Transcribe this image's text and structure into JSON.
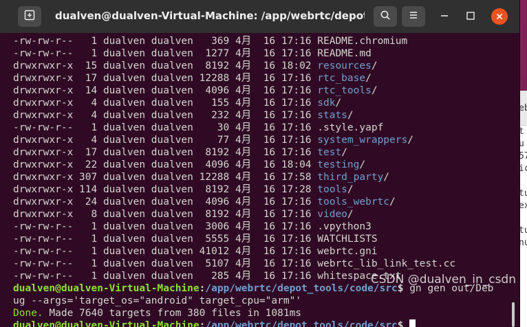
{
  "window": {
    "title": "dualven@dualven-Virtual-Machine: /app/webrtc/depot_tools..."
  },
  "background_window": {
    "fragments": [
      "eb",
      "t",
      "u",
      "57",
      "ic",
      "tu",
      "ex",
      "tu",
      "nu"
    ]
  },
  "listing": [
    {
      "perms": "-rw-rw-r--",
      "links": "1",
      "user": "dualven",
      "group": "dualven",
      "size": "369",
      "month": "4月",
      "day": "16",
      "time": "17:16",
      "name": "README.chromium",
      "is_dir": false
    },
    {
      "perms": "-rw-rw-r--",
      "links": "1",
      "user": "dualven",
      "group": "dualven",
      "size": "1277",
      "month": "4月",
      "day": "16",
      "time": "17:16",
      "name": "README.md",
      "is_dir": false
    },
    {
      "perms": "drwxrwxr-x",
      "links": "15",
      "user": "dualven",
      "group": "dualven",
      "size": "8192",
      "month": "4月",
      "day": "16",
      "time": "18:02",
      "name": "resources",
      "is_dir": true
    },
    {
      "perms": "drwxrwxr-x",
      "links": "17",
      "user": "dualven",
      "group": "dualven",
      "size": "12288",
      "month": "4月",
      "day": "16",
      "time": "17:16",
      "name": "rtc_base",
      "is_dir": true
    },
    {
      "perms": "drwxrwxr-x",
      "links": "14",
      "user": "dualven",
      "group": "dualven",
      "size": "4096",
      "month": "4月",
      "day": "16",
      "time": "17:16",
      "name": "rtc_tools",
      "is_dir": true
    },
    {
      "perms": "drwxrwxr-x",
      "links": "4",
      "user": "dualven",
      "group": "dualven",
      "size": "155",
      "month": "4月",
      "day": "16",
      "time": "17:16",
      "name": "sdk",
      "is_dir": true
    },
    {
      "perms": "drwxrwxr-x",
      "links": "4",
      "user": "dualven",
      "group": "dualven",
      "size": "232",
      "month": "4月",
      "day": "16",
      "time": "17:16",
      "name": "stats",
      "is_dir": true
    },
    {
      "perms": "-rw-rw-r--",
      "links": "1",
      "user": "dualven",
      "group": "dualven",
      "size": "30",
      "month": "4月",
      "day": "16",
      "time": "17:16",
      "name": ".style.yapf",
      "is_dir": false
    },
    {
      "perms": "drwxrwxr-x",
      "links": "4",
      "user": "dualven",
      "group": "dualven",
      "size": "77",
      "month": "4月",
      "day": "16",
      "time": "17:16",
      "name": "system_wrappers",
      "is_dir": true
    },
    {
      "perms": "drwxrwxr-x",
      "links": "17",
      "user": "dualven",
      "group": "dualven",
      "size": "8192",
      "month": "4月",
      "day": "16",
      "time": "17:16",
      "name": "test",
      "is_dir": true
    },
    {
      "perms": "drwxrwxr-x",
      "links": "22",
      "user": "dualven",
      "group": "dualven",
      "size": "4096",
      "month": "4月",
      "day": "16",
      "time": "18:04",
      "name": "testing",
      "is_dir": true
    },
    {
      "perms": "drwxrwxr-x",
      "links": "307",
      "user": "dualven",
      "group": "dualven",
      "size": "12288",
      "month": "4月",
      "day": "16",
      "time": "17:58",
      "name": "third_party",
      "is_dir": true
    },
    {
      "perms": "drwxrwxr-x",
      "links": "114",
      "user": "dualven",
      "group": "dualven",
      "size": "8192",
      "month": "4月",
      "day": "16",
      "time": "17:28",
      "name": "tools",
      "is_dir": true
    },
    {
      "perms": "drwxrwxr-x",
      "links": "24",
      "user": "dualven",
      "group": "dualven",
      "size": "4096",
      "month": "4月",
      "day": "16",
      "time": "17:16",
      "name": "tools_webrtc",
      "is_dir": true
    },
    {
      "perms": "drwxrwxr-x",
      "links": "8",
      "user": "dualven",
      "group": "dualven",
      "size": "8192",
      "month": "4月",
      "day": "16",
      "time": "17:16",
      "name": "video",
      "is_dir": true
    },
    {
      "perms": "-rw-rw-r--",
      "links": "1",
      "user": "dualven",
      "group": "dualven",
      "size": "3006",
      "month": "4月",
      "day": "16",
      "time": "17:16",
      "name": ".vpython3",
      "is_dir": false
    },
    {
      "perms": "-rw-rw-r--",
      "links": "1",
      "user": "dualven",
      "group": "dualven",
      "size": "5555",
      "month": "4月",
      "day": "16",
      "time": "17:16",
      "name": "WATCHLISTS",
      "is_dir": false
    },
    {
      "perms": "-rw-rw-r--",
      "links": "1",
      "user": "dualven",
      "group": "dualven",
      "size": "41012",
      "month": "4月",
      "day": "16",
      "time": "17:16",
      "name": "webrtc.gni",
      "is_dir": false
    },
    {
      "perms": "-rw-rw-r--",
      "links": "1",
      "user": "dualven",
      "group": "dualven",
      "size": "5107",
      "month": "4月",
      "day": "16",
      "time": "17:16",
      "name": "webrtc_lib_link_test.cc",
      "is_dir": false
    },
    {
      "perms": "-rw-rw-r--",
      "links": "1",
      "user": "dualven",
      "group": "dualven",
      "size": "285",
      "month": "4月",
      "day": "16",
      "time": "17:16",
      "name": "whitespace.txt",
      "is_dir": false
    }
  ],
  "prompt": {
    "user_host": "dualven@dualven-Virtual-Machine",
    "separator": ":",
    "path": "/app/webrtc/depot_tools/code/src",
    "symbol": "$",
    "command": "gn gen out/Deb",
    "command_wrap": "ug --args='target_os=\"android\" target_cpu=\"arm\"'"
  },
  "output": {
    "done_label": "Done.",
    "message": " Made 7640 targets from 380 files in 1081ms"
  },
  "prompt2": {
    "user_host": "dualven@dualven-Virtual-Machine",
    "separator": ":",
    "path": "/app/webrtc/depot_tools/code/src",
    "symbol": "$"
  },
  "watermark": "CSDN @dualven_in_csdn"
}
